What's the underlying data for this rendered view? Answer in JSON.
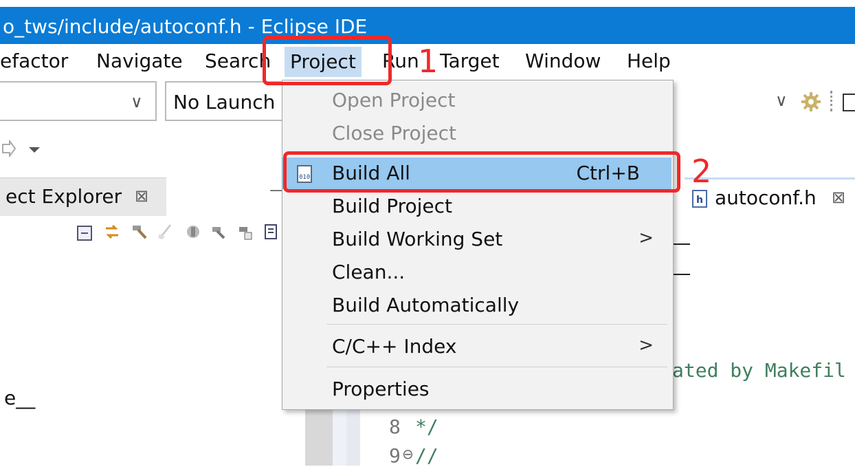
{
  "window": {
    "title": "o_tws/include/autoconf.h - Eclipse IDE"
  },
  "menubar": {
    "items": [
      "efactor",
      "Navigate",
      "Search",
      "Project",
      "Run",
      "Target",
      "Window",
      "Help"
    ]
  },
  "toolbar": {
    "launch_mode": "No Launch",
    "chevron": "∨"
  },
  "explorer": {
    "tab_label": "ect Explorer",
    "close_glyph": "⊠",
    "minimize_glyph": "—",
    "tree_text": "e__"
  },
  "editor": {
    "tab_label": "autoconf.h",
    "close_glyph": "⊠",
    "file_icon_letter": "h",
    "visible_code": "ated by Makefil",
    "lines": [
      {
        "num": "8",
        "fold": "",
        "text": "*/"
      },
      {
        "num": "9",
        "fold": "⊖",
        "text": "//"
      }
    ]
  },
  "dropdown": {
    "items": [
      {
        "label": "Open Project",
        "enabled": false
      },
      {
        "label": "Close Project",
        "enabled": false
      },
      {
        "label": "Build All",
        "shortcut": "Ctrl+B",
        "selected": true,
        "icon": "build-all-icon",
        "icon_text": "010"
      },
      {
        "label": "Build Project"
      },
      {
        "label": "Build Working Set",
        "submenu": true
      },
      {
        "label": "Clean..."
      },
      {
        "label": "Build Automatically"
      },
      {
        "label": "C/C++ Index",
        "submenu": true
      },
      {
        "label": "Properties"
      }
    ],
    "submenu_arrow": ">"
  },
  "annotations": {
    "step1": "1",
    "step2": "2"
  },
  "colors": {
    "titlebar": "#0b7bd5",
    "menu_highlight": "#c6dcf3",
    "selected_item": "#96c8f0",
    "annotation": "#f0282a",
    "comment": "#3f7f5f"
  }
}
